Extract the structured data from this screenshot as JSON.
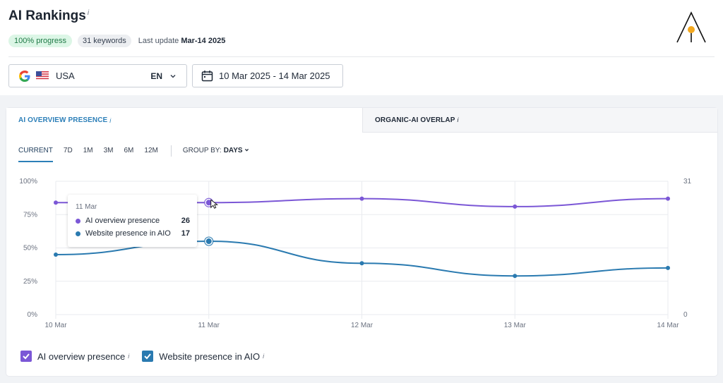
{
  "header": {
    "title": "AI Rankings",
    "info_marker": "i",
    "progress_badge": "100% progress",
    "keywords_badge": "31 keywords",
    "last_update_label": "Last update",
    "last_update_value": "Mar-14 2025"
  },
  "filters": {
    "country": "USA",
    "language": "EN",
    "date_range": "10 Mar 2025 - 14 Mar 2025"
  },
  "tabs": [
    {
      "label": "AI OVERVIEW PRESENCE",
      "active": true
    },
    {
      "label": "ORGANIC-AI OVERLAP",
      "active": false
    }
  ],
  "periods": [
    "CURRENT",
    "7D",
    "1M",
    "3M",
    "6M",
    "12M"
  ],
  "active_period": "CURRENT",
  "group_by": {
    "label": "GROUP BY:",
    "value": "DAYS"
  },
  "tooltip": {
    "date": "11 Mar",
    "rows": [
      {
        "label": "AI overview presence",
        "value": "26"
      },
      {
        "label": "Website presence in AIO",
        "value": "17"
      }
    ]
  },
  "legend": [
    {
      "label": "AI overview presence",
      "checked": true
    },
    {
      "label": "Website presence in AIO",
      "checked": true
    }
  ],
  "colors": {
    "accent": "#2c7fb8",
    "ai_overview": "#7b57d6",
    "website": "#2a7ab0",
    "progress_badge_bg": "#dcf6e6"
  },
  "icons": [
    "google-icon",
    "usa-flag-icon",
    "chevron-down-icon",
    "calendar-icon",
    "logo-icon",
    "mouse-cursor-icon"
  ],
  "chart_data": {
    "type": "line",
    "categories": [
      "10 Mar",
      "11 Mar",
      "12 Mar",
      "13 Mar",
      "14 Mar"
    ],
    "y_left_ticks": [
      "100%",
      "75%",
      "50%",
      "25%",
      "0%"
    ],
    "y_right_ticks": [
      "31",
      "0"
    ],
    "ylim_left": [
      0,
      100
    ],
    "ylim_right": [
      0,
      31
    ],
    "series": [
      {
        "name": "AI overview presence",
        "color": "#7b57d6",
        "values": [
          84,
          84,
          87,
          81,
          87
        ]
      },
      {
        "name": "Website presence in AIO",
        "color": "#2a7ab0",
        "values": [
          45,
          55,
          38.5,
          29,
          35
        ]
      }
    ],
    "hover_index": 1,
    "grid": true,
    "legend_position": "bottom-left"
  }
}
